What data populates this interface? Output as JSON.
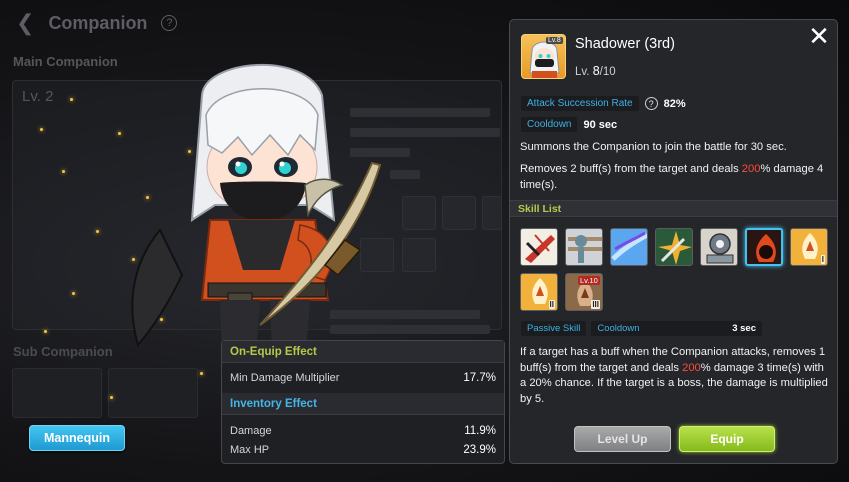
{
  "background": {
    "header_title": "Companion",
    "help_icon": "?",
    "main_label": "Main Companion",
    "level_text": "Lv. 2",
    "sub_label": "Sub Companion"
  },
  "effects": {
    "on_equip_header": "On-Equip Effect",
    "on_equip": [
      {
        "label": "Min Damage Multiplier",
        "value": "17.7%"
      }
    ],
    "inventory_header": "Inventory Effect",
    "inventory": [
      {
        "label": "Damage",
        "value": "11.9%"
      },
      {
        "label": "Max HP",
        "value": "23.9%"
      }
    ]
  },
  "buttons": {
    "mannequin": "Mannequin",
    "level_up": "Level Up",
    "equip": "Equip",
    "close_icon": "close-icon"
  },
  "skill": {
    "portrait_tag": "Lv.8",
    "name": "Shadower (3rd)",
    "level_prefix": "Lv.",
    "level_current": "8",
    "level_max": "/10",
    "stat1_label": "Attack Succession Rate",
    "stat1_value": "82%",
    "stat2_label": "Cooldown",
    "stat2_value": "90 sec",
    "desc1": "Summons the Companion to join the battle for 30 sec.",
    "desc2_a": "Removes 2 buff(s) from the target and deals ",
    "desc2_hl": "200",
    "desc2_b": "% damage 4 time(s).",
    "list_title": "Skill List",
    "icons": [
      {
        "name": "skill-slash-icon",
        "colors": [
          "#f3eee4",
          "#c9342b"
        ]
      },
      {
        "name": "skill-totem-icon",
        "colors": [
          "#cfd3d7",
          "#8a6a4a"
        ]
      },
      {
        "name": "skill-wind-icon",
        "colors": [
          "#5aa7f0",
          "#c6e6ff"
        ]
      },
      {
        "name": "skill-dagger-icon",
        "colors": [
          "#2a5a3a",
          "#f0b030"
        ]
      },
      {
        "name": "skill-tile-icon",
        "colors": [
          "#d8d4cc",
          "#6f7b86"
        ]
      },
      {
        "name": "skill-shadow-flame-icon",
        "colors": [
          "#2a1512",
          "#e04a1c"
        ]
      },
      {
        "name": "skill-fire-emblem-icon",
        "colors": [
          "#f2b13a",
          "#fff1c8"
        ]
      },
      {
        "name": "skill-fire-emblem-2-icon",
        "colors": [
          "#f2b13a",
          "#fff1c8"
        ]
      },
      {
        "name": "skill-fire-emblem-3-icon",
        "colors": [
          "#8b6a4a",
          "#d8b08a"
        ]
      }
    ],
    "icon_badges": {
      "roman_1": "I",
      "roman_2": "II",
      "roman_3": "III",
      "lv10": "Lv.10"
    },
    "passive_label": "Passive Skill",
    "cooldown_label": "Cooldown",
    "cooldown_value": "3 sec",
    "passive_a": "If a target has a buff when the Companion attacks, removes 1 buff(s) from the target and deals ",
    "passive_hl": "200",
    "passive_b": "% damage 3 time(s) with a 20% chance. If the target is a boss, the damage is multiplied by 5."
  }
}
